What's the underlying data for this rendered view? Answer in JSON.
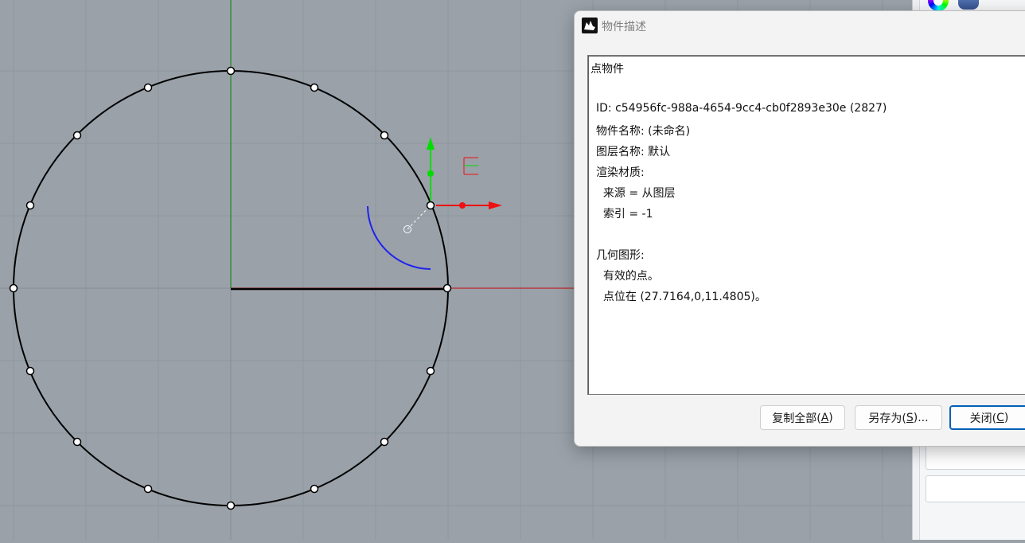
{
  "dialog": {
    "title": "物件描述",
    "lines": [
      "点物件",
      "",
      "ID: c54956fc-988a-4654-9cc4-cb0f2893e30e (2827)",
      "物件名称: (未命名)",
      "图层名称: 默认",
      "渲染材质:",
      "  来源 = 从图层",
      "  索引 = -1",
      "",
      "几何图形:",
      "  有效的点。",
      "  点位在 (27.7164,0,11.4805)。"
    ],
    "buttons": {
      "copy_all": {
        "label": "复制全部(",
        "mnemonic": "A",
        "suffix": ")"
      },
      "save_as": {
        "label": "另存为(",
        "mnemonic": "S",
        "suffix": ")..."
      },
      "close": {
        "label": "关闭(",
        "mnemonic": "C",
        "suffix": ")"
      }
    }
  },
  "colors": {
    "viewport_bg": "#9aa1a9",
    "grid_line": "#8c939b",
    "x_axis": "#c0262a",
    "y_axis": "#1f8a24",
    "circle": "#000000",
    "arc": "#1f22ee",
    "gumball_green": "#00dd00",
    "gumball_red": "#ee1111",
    "button_accent": "#005fb8"
  },
  "icons": {
    "dialog_title": "rhino-icon",
    "color_wheel": "color-wheel-icon",
    "layers": "database-icon"
  }
}
